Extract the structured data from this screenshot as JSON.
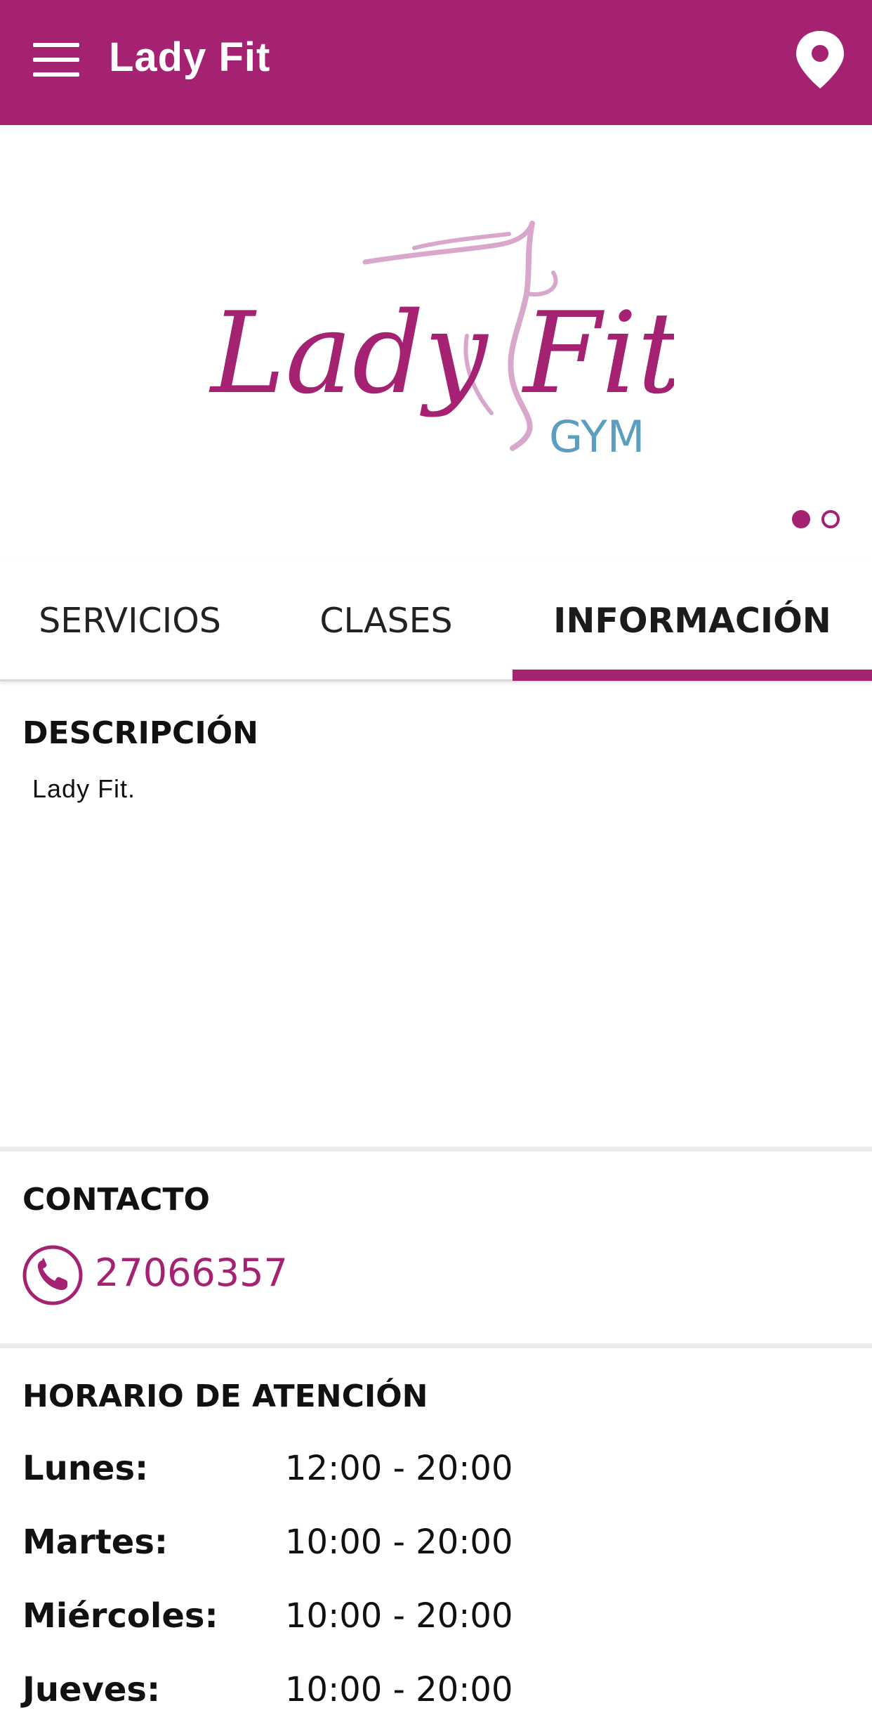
{
  "appbar": {
    "title": "Lady Fit",
    "menu_icon": "hamburger-menu-icon",
    "location_icon": "map-pin-icon"
  },
  "banner": {
    "logo_text": "Lady Fit",
    "logo_subtext": "GYM",
    "slides_total": 2,
    "slide_active": 1
  },
  "tabs": [
    {
      "label": "SERVICIOS",
      "selected": false
    },
    {
      "label": "CLASES",
      "selected": false
    },
    {
      "label": "INFORMACIÓN",
      "selected": true
    }
  ],
  "description": {
    "title": "DESCRIPCIÓN",
    "text": "Lady Fit."
  },
  "contact": {
    "title": "CONTACTO",
    "phone": "27066357",
    "phone_icon": "phone-icon"
  },
  "hours": {
    "title": "HORARIO DE ATENCIÓN",
    "rows": [
      {
        "day": "Lunes:",
        "time": "12:00 - 20:00"
      },
      {
        "day": "Martes:",
        "time": "10:00 - 20:00"
      },
      {
        "day": "Miércoles:",
        "time": "10:00 - 20:00"
      },
      {
        "day": "Jueves:",
        "time": "10:00 - 20:00"
      }
    ]
  },
  "colors": {
    "brand": "#a52273",
    "logo_pink": "#a52273",
    "logo_light": "#d9a6cc",
    "logo_blue": "#5b9ec0",
    "divider": "#ececee"
  }
}
